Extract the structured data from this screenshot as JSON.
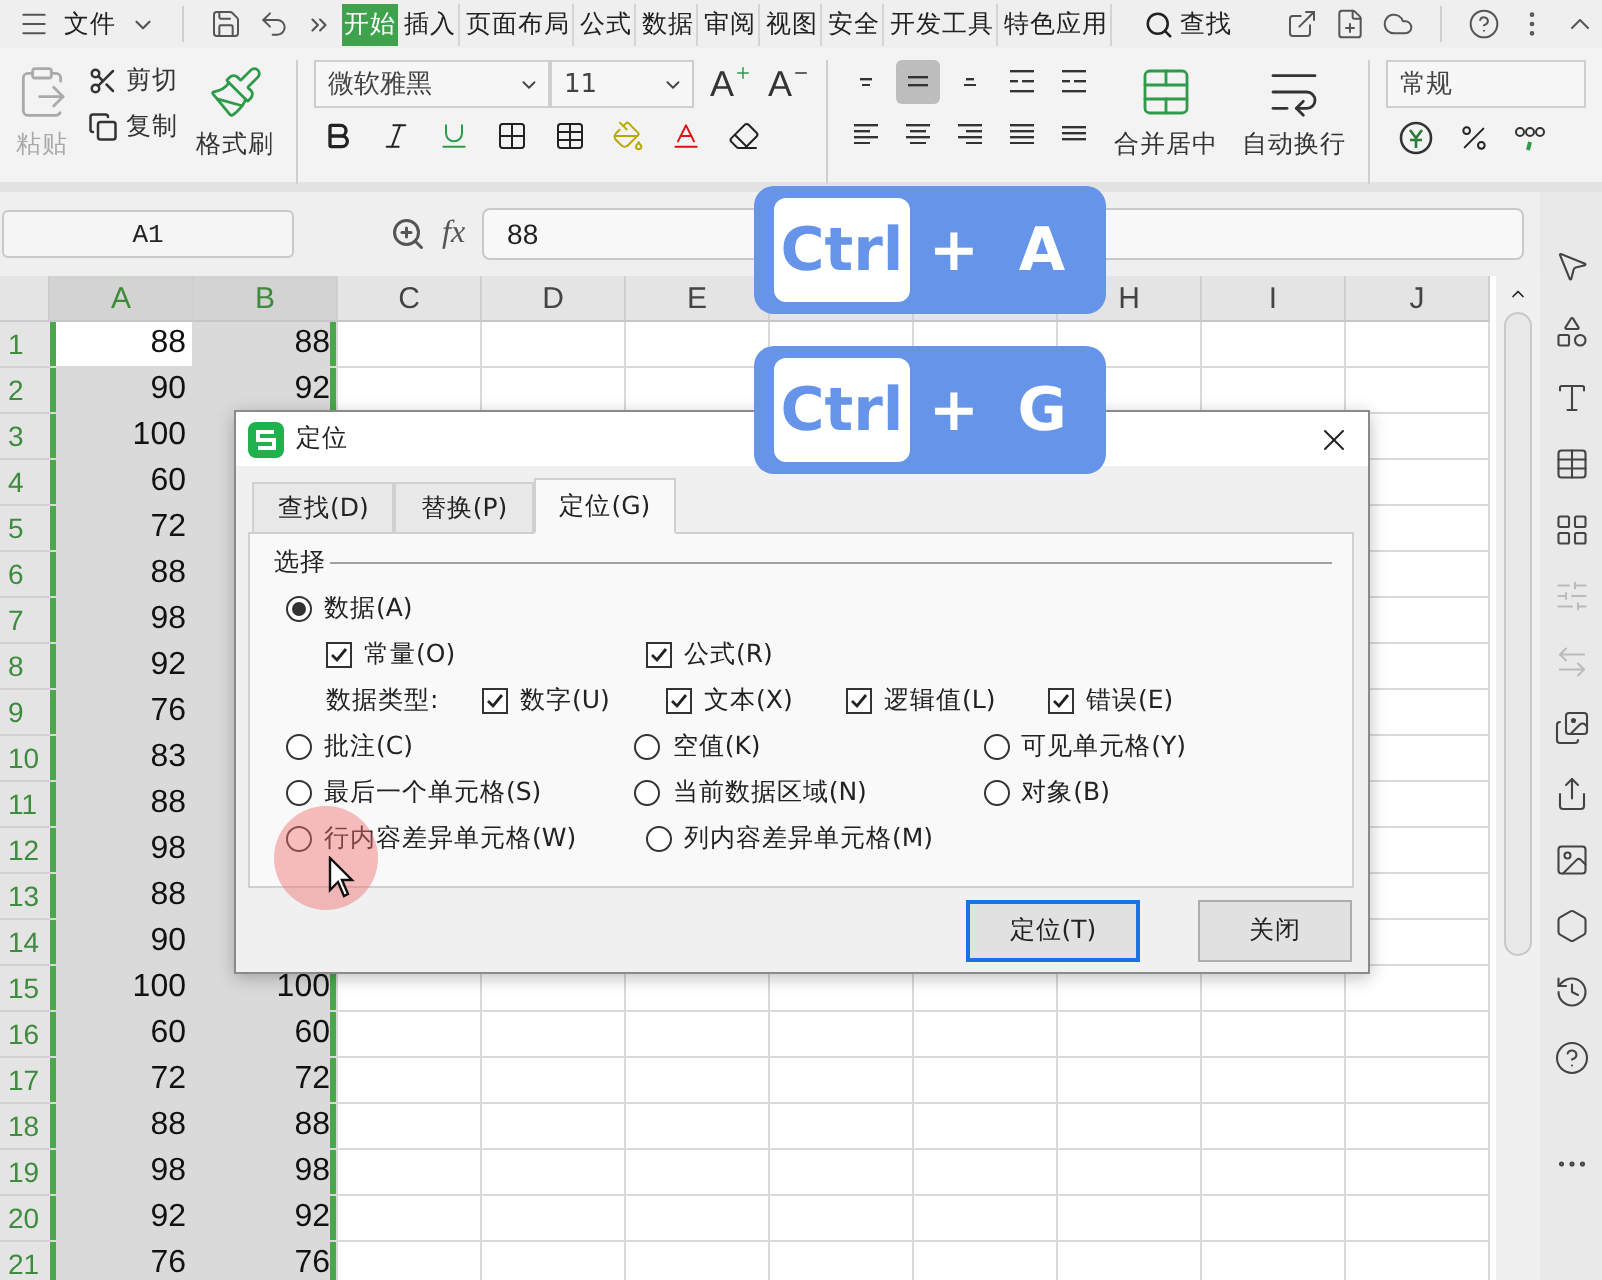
{
  "menu_bar": {
    "file_menu": "文件",
    "tabs": [
      {
        "label": "开始",
        "selected": true
      },
      {
        "label": "插入",
        "selected": false
      },
      {
        "label": "页面布局",
        "selected": false
      },
      {
        "label": "公式",
        "selected": false
      },
      {
        "label": "数据",
        "selected": false
      },
      {
        "label": "审阅",
        "selected": false
      },
      {
        "label": "视图",
        "selected": false
      },
      {
        "label": "安全",
        "selected": false
      },
      {
        "label": "开发工具",
        "selected": false
      },
      {
        "label": "特色应用",
        "selected": false
      }
    ],
    "search": "查找"
  },
  "ribbon": {
    "paste": {
      "label": "粘贴",
      "disabled": true
    },
    "cut": "剪切",
    "copy": "复制",
    "format_painter": "格式刷",
    "font_name": "微软雅黑",
    "font_size": "11",
    "font_size_buttons": [
      {
        "label": "A",
        "kind": "grow"
      },
      {
        "label": "A",
        "kind": "shrink"
      }
    ],
    "vertical_align": [
      {
        "selected": false
      },
      {
        "selected": true
      },
      {
        "selected": false
      }
    ],
    "merge_center": "合并居中",
    "wrap_text": "自动换行",
    "number_format": "常规"
  },
  "formula_bar": {
    "name_box": "A1",
    "function_label": "fx",
    "value": "88"
  },
  "sheet": {
    "columns": [
      {
        "label": "A",
        "selected": true
      },
      {
        "label": "B",
        "selected": true
      },
      {
        "label": "C",
        "selected": false
      },
      {
        "label": "D",
        "selected": false
      },
      {
        "label": "E",
        "selected": false
      },
      {},
      {},
      {
        "label": "H",
        "selected": false
      },
      {
        "label": "I",
        "selected": false
      },
      {
        "label": "J",
        "selected": false
      }
    ],
    "rows": [
      {
        "number": "1",
        "a": "88",
        "b": "88",
        "active": true
      },
      {
        "number": "2",
        "a": "90",
        "b": "92",
        "active": false
      },
      {
        "number": "3",
        "a": "100",
        "active": false
      },
      {
        "number": "4",
        "a": "60",
        "active": false
      },
      {
        "number": "5",
        "a": "72",
        "active": false
      },
      {
        "number": "6",
        "a": "88",
        "active": false
      },
      {
        "number": "7",
        "a": "98",
        "active": false
      },
      {
        "number": "8",
        "a": "92",
        "active": false
      },
      {
        "number": "9",
        "a": "76",
        "active": false
      },
      {
        "number": "10",
        "a": "83",
        "active": false
      },
      {
        "number": "11",
        "a": "88",
        "active": false
      },
      {
        "number": "12",
        "a": "98",
        "active": false
      },
      {
        "number": "13",
        "a": "88",
        "active": false
      },
      {
        "number": "14",
        "a": "90",
        "active": false
      },
      {
        "number": "15",
        "a": "100",
        "b": "100",
        "active": false
      },
      {
        "number": "16",
        "a": "60",
        "b": "60",
        "active": false
      },
      {
        "number": "17",
        "a": "72",
        "b": "72",
        "active": false
      },
      {
        "number": "18",
        "a": "88",
        "b": "88",
        "active": false
      },
      {
        "number": "19",
        "a": "98",
        "b": "98",
        "active": false
      },
      {
        "number": "20",
        "a": "92",
        "b": "92",
        "active": false
      },
      {
        "number": "21",
        "a": "76",
        "b": "76",
        "active": false
      }
    ]
  },
  "dialog": {
    "title": "定位",
    "tabs": [
      {
        "label": "查找(D)",
        "selected": false
      },
      {
        "label": "替换(P)",
        "selected": false
      },
      {
        "label": "定位(G)",
        "selected": true
      }
    ],
    "group_label": "选择",
    "data_option": {
      "label": "数据(A)",
      "selected": true
    },
    "data_checks": [
      {
        "label": "常量(O)",
        "checked": true
      },
      {
        "label": "公式(R)",
        "checked": true
      }
    ],
    "data_types_label": "数据类型:",
    "data_types": [
      {
        "label": "数字(U)",
        "checked": true
      },
      {
        "label": "文本(X)",
        "checked": true
      },
      {
        "label": "逻辑值(L)",
        "checked": true
      },
      {
        "label": "错误(E)",
        "checked": true
      }
    ],
    "option_rows": [
      [
        {
          "label": "批注(C)",
          "selected": false
        },
        {
          "label": "空值(K)",
          "selected": false
        },
        {
          "label": "可见单元格(Y)",
          "selected": false
        }
      ],
      [
        {
          "label": "最后一个单元格(S)",
          "selected": false
        },
        {
          "label": "当前数据区域(N)",
          "selected": false
        },
        {
          "label": "对象(B)",
          "selected": false
        }
      ],
      [
        {
          "label": "行内容差异单元格(W)",
          "selected": false
        },
        {
          "label": "列内容差异单元格(M)",
          "selected": false
        }
      ]
    ],
    "buttons": [
      {
        "label": "定位(T)",
        "kind": "default"
      },
      {
        "label": "关闭",
        "kind": "normal"
      }
    ]
  },
  "shortcuts": [
    {
      "keys": [
        {
          "label": "Ctrl",
          "kind": "key"
        },
        {
          "label": "+",
          "kind": "plus"
        },
        {
          "label": "A",
          "kind": "letter"
        }
      ]
    },
    {
      "keys": [
        {
          "label": "Ctrl",
          "kind": "key"
        },
        {
          "label": "+",
          "kind": "plus"
        },
        {
          "label": "G",
          "kind": "letter"
        }
      ]
    }
  ]
}
